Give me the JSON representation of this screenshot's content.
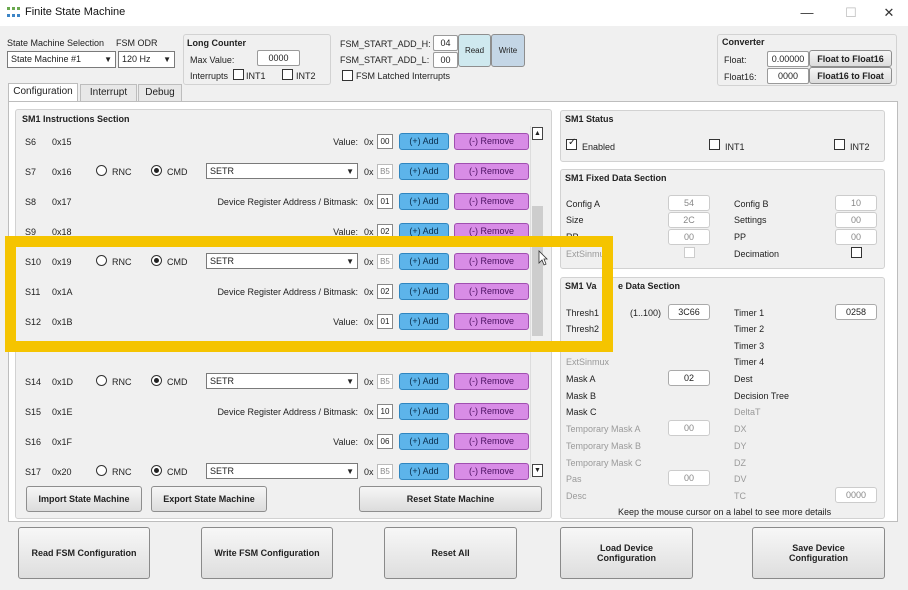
{
  "window": {
    "title": "Finite State Machine",
    "minimize": "—",
    "maximize": "☐",
    "close": "✕"
  },
  "top": {
    "sm_selection_label": "State Machine Selection",
    "sm_selection_value": "State Machine #1",
    "odr_label": "FSM ODR",
    "odr_value": "120 Hz",
    "long_counter_title": "Long Counter",
    "max_value_label": "Max Value:",
    "max_value": "0000",
    "interrupts_label": "Interrupts",
    "int1": "INT1",
    "int2": "INT2",
    "start_add_h_label": "FSM_START_ADD_H:",
    "start_add_h": "04",
    "start_add_l_label": "FSM_START_ADD_L:",
    "start_add_l": "00",
    "read": "Read",
    "write": "Write",
    "latched": "FSM Latched Interrupts",
    "converter_title": "Converter",
    "float_label": "Float:",
    "float_value": "0.00000",
    "float_btn": "Float to Float16",
    "float16_label": "Float16:",
    "float16_value": "0000",
    "float16_btn": "Float16 to Float"
  },
  "tabs": [
    "Configuration",
    "Interrupt",
    "Debug"
  ],
  "instructions": {
    "title": "SM1 Instructions Section",
    "value_label": "Value:",
    "addr_label": "Device Register Address / Bitmask:",
    "hex_prefix": "0x",
    "rnc": "RNC",
    "cmd": "CMD",
    "add": "(+) Add",
    "remove": "(-) Remove",
    "rows": [
      {
        "s": "S6",
        "hex": "0x15",
        "type": "value",
        "v1": "00"
      },
      {
        "s": "S7",
        "hex": "0x16",
        "type": "cmd",
        "cmd": "SETR",
        "v1": "B5"
      },
      {
        "s": "S8",
        "hex": "0x17",
        "type": "addr",
        "v1": "01"
      },
      {
        "s": "S9",
        "hex": "0x18",
        "type": "value",
        "v1": "02"
      },
      {
        "s": "S10",
        "hex": "0x19",
        "type": "cmd",
        "cmd": "SETR",
        "v1": "B5"
      },
      {
        "s": "S11",
        "hex": "0x1A",
        "type": "addr",
        "v1": "02"
      },
      {
        "s": "S12",
        "hex": "0x1B",
        "type": "value",
        "v1": "01"
      },
      {
        "s": "S14",
        "hex": "0x1D",
        "type": "cmd",
        "cmd": "SETR",
        "v1": "B5"
      },
      {
        "s": "S15",
        "hex": "0x1E",
        "type": "addr",
        "v1": "10"
      },
      {
        "s": "S16",
        "hex": "0x1F",
        "type": "value",
        "v1": "06"
      },
      {
        "s": "S17",
        "hex": "0x20",
        "type": "cmd",
        "cmd": "SETR",
        "v1": "B5"
      }
    ],
    "import": "Import State Machine",
    "export": "Export State Machine",
    "reset": "Reset State Machine"
  },
  "status": {
    "title": "SM1 Status",
    "enabled": "Enabled",
    "int1": "INT1",
    "int2": "INT2"
  },
  "fixed": {
    "title": "SM1 Fixed Data Section",
    "config_a": "Config A",
    "config_a_v": "54",
    "config_b": "Config B",
    "config_b_v": "10",
    "size": "Size",
    "size_v": "2C",
    "settings": "Settings",
    "settings_v": "00",
    "rp": "RP",
    "rp_v": "00",
    "pp": "PP",
    "pp_v": "00",
    "extsinmux": "ExtSinmux",
    "decimation": "Decimation"
  },
  "variable": {
    "title_a": "SM1 Va",
    "title_b": "e Data Section",
    "thresh1": "Thresh1",
    "thresh1_range": "(1..100)",
    "thresh1_v": "3C66",
    "thresh2": "Thresh2",
    "timer1": "Timer 1",
    "timer1_v": "0258",
    "timer2": "Timer 2",
    "timer3": "Timer 3",
    "timer4": "Timer 4",
    "extsinmux": "ExtSinmux",
    "mask_a": "Mask A",
    "mask_a_v": "02",
    "dest": "Dest",
    "mask_b": "Mask B",
    "decision_tree": "Decision Tree",
    "mask_c": "Mask C",
    "delta_t": "DeltaT",
    "tmask_a": "Temporary Mask A",
    "tmask_a_v": "00",
    "dx": "DX",
    "tmask_b": "Temporary Mask B",
    "dy": "DY",
    "tmask_c": "Temporary Mask C",
    "dz": "DZ",
    "pas": "Pas",
    "pas_v": "00",
    "dv": "DV",
    "desc": "Desc",
    "tc": "TC",
    "tc_v": "0000",
    "hint": "Keep the mouse cursor on a label to see more details"
  },
  "bottom": {
    "read_fsm": "Read FSM Configuration",
    "write_fsm": "Write FSM Configuration",
    "reset_all": "Reset All",
    "load_device": "Load Device Configuration",
    "save_device": "Save Device Configuration"
  }
}
